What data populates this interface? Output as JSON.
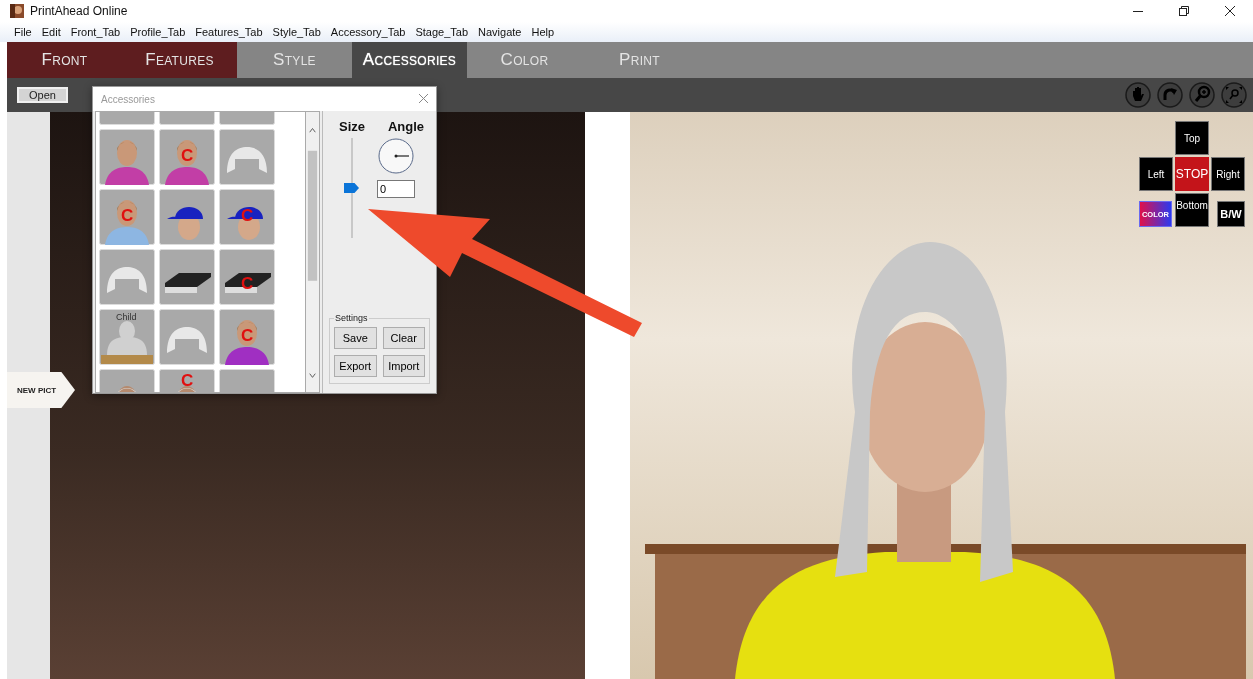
{
  "window": {
    "title": "PrintAhead Online"
  },
  "menu": [
    "File",
    "Edit",
    "Front_Tab",
    "Profile_Tab",
    "Features_Tab",
    "Style_Tab",
    "Accessory_Tab",
    "Stage_Tab",
    "Navigate",
    "Help"
  ],
  "tabs": [
    {
      "label": "Front",
      "color": "#5e1d1f",
      "selected": false
    },
    {
      "label": "Features",
      "color": "#5e1d1f",
      "selected": false
    },
    {
      "label": "Style",
      "color": "#858585",
      "selected": false
    },
    {
      "label": "Accessories",
      "color": "#474747",
      "selected": true
    },
    {
      "label": "Color",
      "color": "#858585",
      "selected": false
    },
    {
      "label": "Print",
      "color": "#858585",
      "selected": false
    }
  ],
  "toolbar": {
    "open_button": "Open"
  },
  "new_pict_button": "NEW PICT",
  "accessories_dialog": {
    "title": "Accessories",
    "thumbnails": [
      [
        {
          "kind": "blank"
        },
        {
          "kind": "blank"
        },
        {
          "kind": "blank"
        }
      ],
      [
        {
          "kind": "figure",
          "color": "#c23ea6"
        },
        {
          "kind": "figure",
          "color": "#c23ea6",
          "badge": "C"
        },
        {
          "kind": "shirt"
        }
      ],
      [
        {
          "kind": "figure",
          "color": "#8db6e2",
          "badge": "C"
        },
        {
          "kind": "cap"
        },
        {
          "kind": "cap",
          "badge": "C"
        }
      ],
      [
        {
          "kind": "shirt"
        },
        {
          "kind": "shelf"
        },
        {
          "kind": "shelf",
          "badge": "C"
        }
      ],
      [
        {
          "kind": "bust",
          "caption": "Child"
        },
        {
          "kind": "shirt"
        },
        {
          "kind": "figure",
          "color": "#a02fc2",
          "badge": "C"
        }
      ],
      [
        {
          "kind": "elder"
        },
        {
          "kind": "elder",
          "badge": "C"
        },
        {
          "kind": "dish"
        }
      ]
    ],
    "size_label": "Size",
    "angle_label": "Angle",
    "size_slider": {
      "level": 0.5
    },
    "angle_field": {
      "value": "0"
    },
    "settings": {
      "title": "Settings",
      "buttons": [
        "Save",
        "Clear",
        "Export",
        "Import"
      ]
    }
  },
  "view_controls": [
    {
      "kind": "top",
      "label": "Top"
    },
    {
      "kind": "left",
      "label": "Left"
    },
    {
      "kind": "stop",
      "label": "STOP"
    },
    {
      "kind": "right",
      "label": "Right"
    },
    {
      "kind": "color",
      "label": "COLOR"
    },
    {
      "kind": "bottom",
      "label": "Bottom"
    },
    {
      "kind": "bw",
      "label": "B/W"
    }
  ]
}
